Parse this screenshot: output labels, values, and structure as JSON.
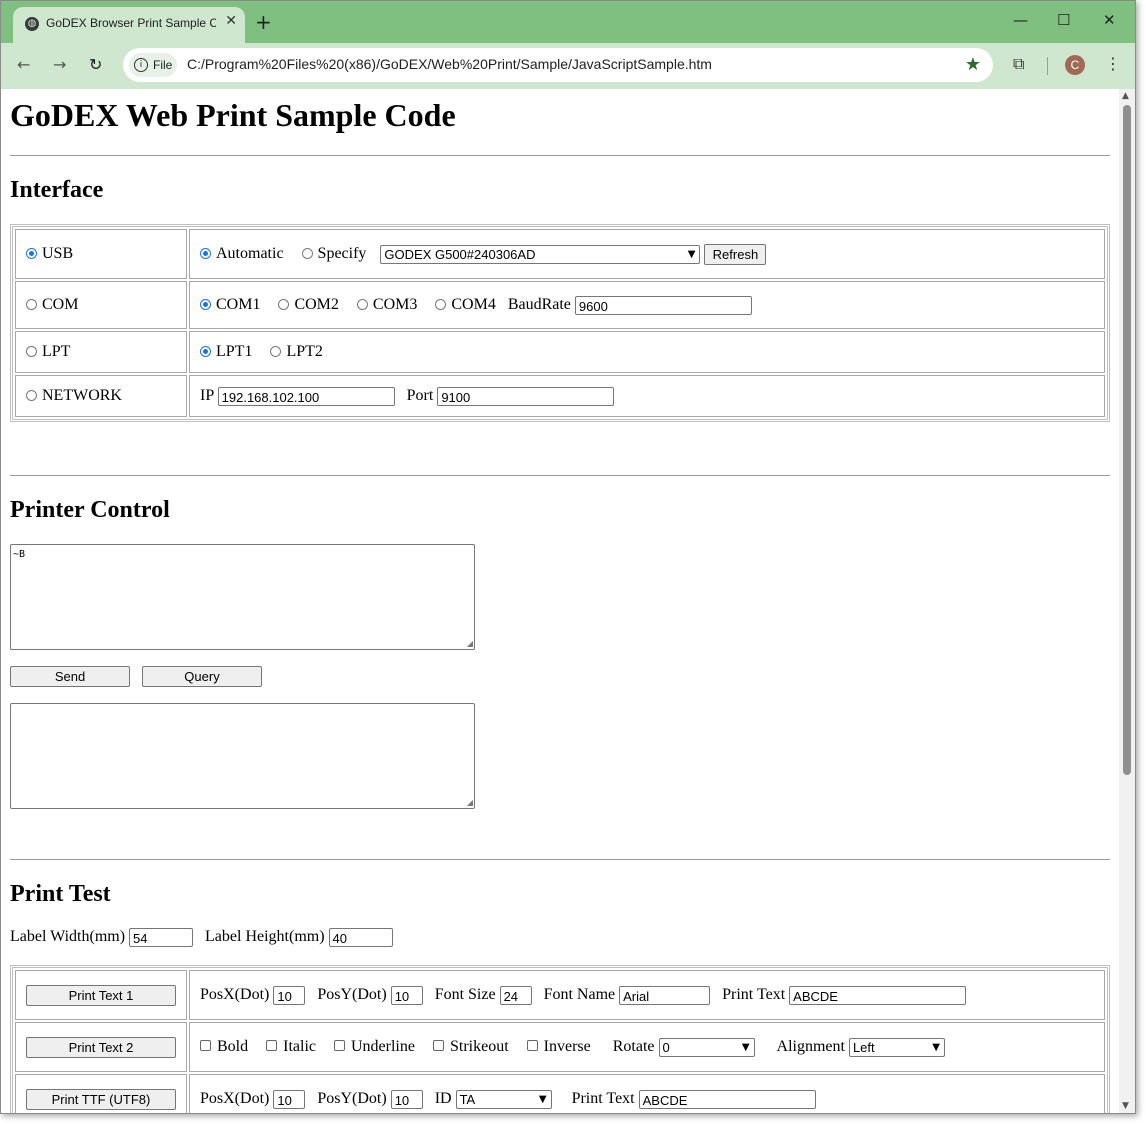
{
  "browser": {
    "tab_title": "GoDEX Browser Print Sample Co",
    "new_tab": "+",
    "chip_label": "File",
    "url": "C:/Program%20Files%20(x86)/GoDEX/Web%20Print/Sample/JavaScriptSample.htm",
    "avatar_letter": "C",
    "controls": {
      "minimize": "—",
      "maximize": "☐",
      "close": "✕"
    }
  },
  "page": {
    "title": "GoDEX Web Print Sample Code",
    "interface": {
      "heading": "Interface",
      "usb": {
        "label": "USB",
        "auto": "Automatic",
        "specify": "Specify",
        "device": "GODEX G500#240306AD",
        "refresh": "Refresh"
      },
      "com": {
        "label": "COM",
        "ports": [
          "COM1",
          "COM2",
          "COM3",
          "COM4"
        ],
        "baud_label": "BaudRate",
        "baud": "9600"
      },
      "lpt": {
        "label": "LPT",
        "ports": [
          "LPT1",
          "LPT2"
        ]
      },
      "network": {
        "label": "NETWORK",
        "ip_label": "IP",
        "ip": "192.168.102.100",
        "port_label": "Port",
        "port": "9100"
      }
    },
    "printer_control": {
      "heading": "Printer Control",
      "command": "~B",
      "send": "Send",
      "query": "Query",
      "response": ""
    },
    "print_test": {
      "heading": "Print Test",
      "label_width_label": "Label Width(mm)",
      "label_width": "54",
      "label_height_label": "Label Height(mm)",
      "label_height": "40",
      "row1": {
        "button": "Print Text 1",
        "posx_label": "PosX(Dot)",
        "posx": "10",
        "posy_label": "PosY(Dot)",
        "posy": "10",
        "fontsize_label": "Font Size",
        "fontsize": "24",
        "fontname_label": "Font Name",
        "fontname": "Arial",
        "text_label": "Print Text",
        "text": "ABCDE"
      },
      "row2": {
        "button": "Print Text 2",
        "bold": "Bold",
        "italic": "Italic",
        "underline": "Underline",
        "strikeout": "Strikeout",
        "inverse": "Inverse",
        "rotate_label": "Rotate",
        "rotate": "0",
        "align_label": "Alignment",
        "align": "Left"
      },
      "row3": {
        "button": "Print TTF (UTF8)",
        "posx_label": "PosX(Dot)",
        "posx": "10",
        "posy_label": "PosY(Dot)",
        "posy": "10",
        "id_label": "ID",
        "id": "TA",
        "text_label": "Print Text",
        "text": "ABCDE"
      }
    }
  }
}
